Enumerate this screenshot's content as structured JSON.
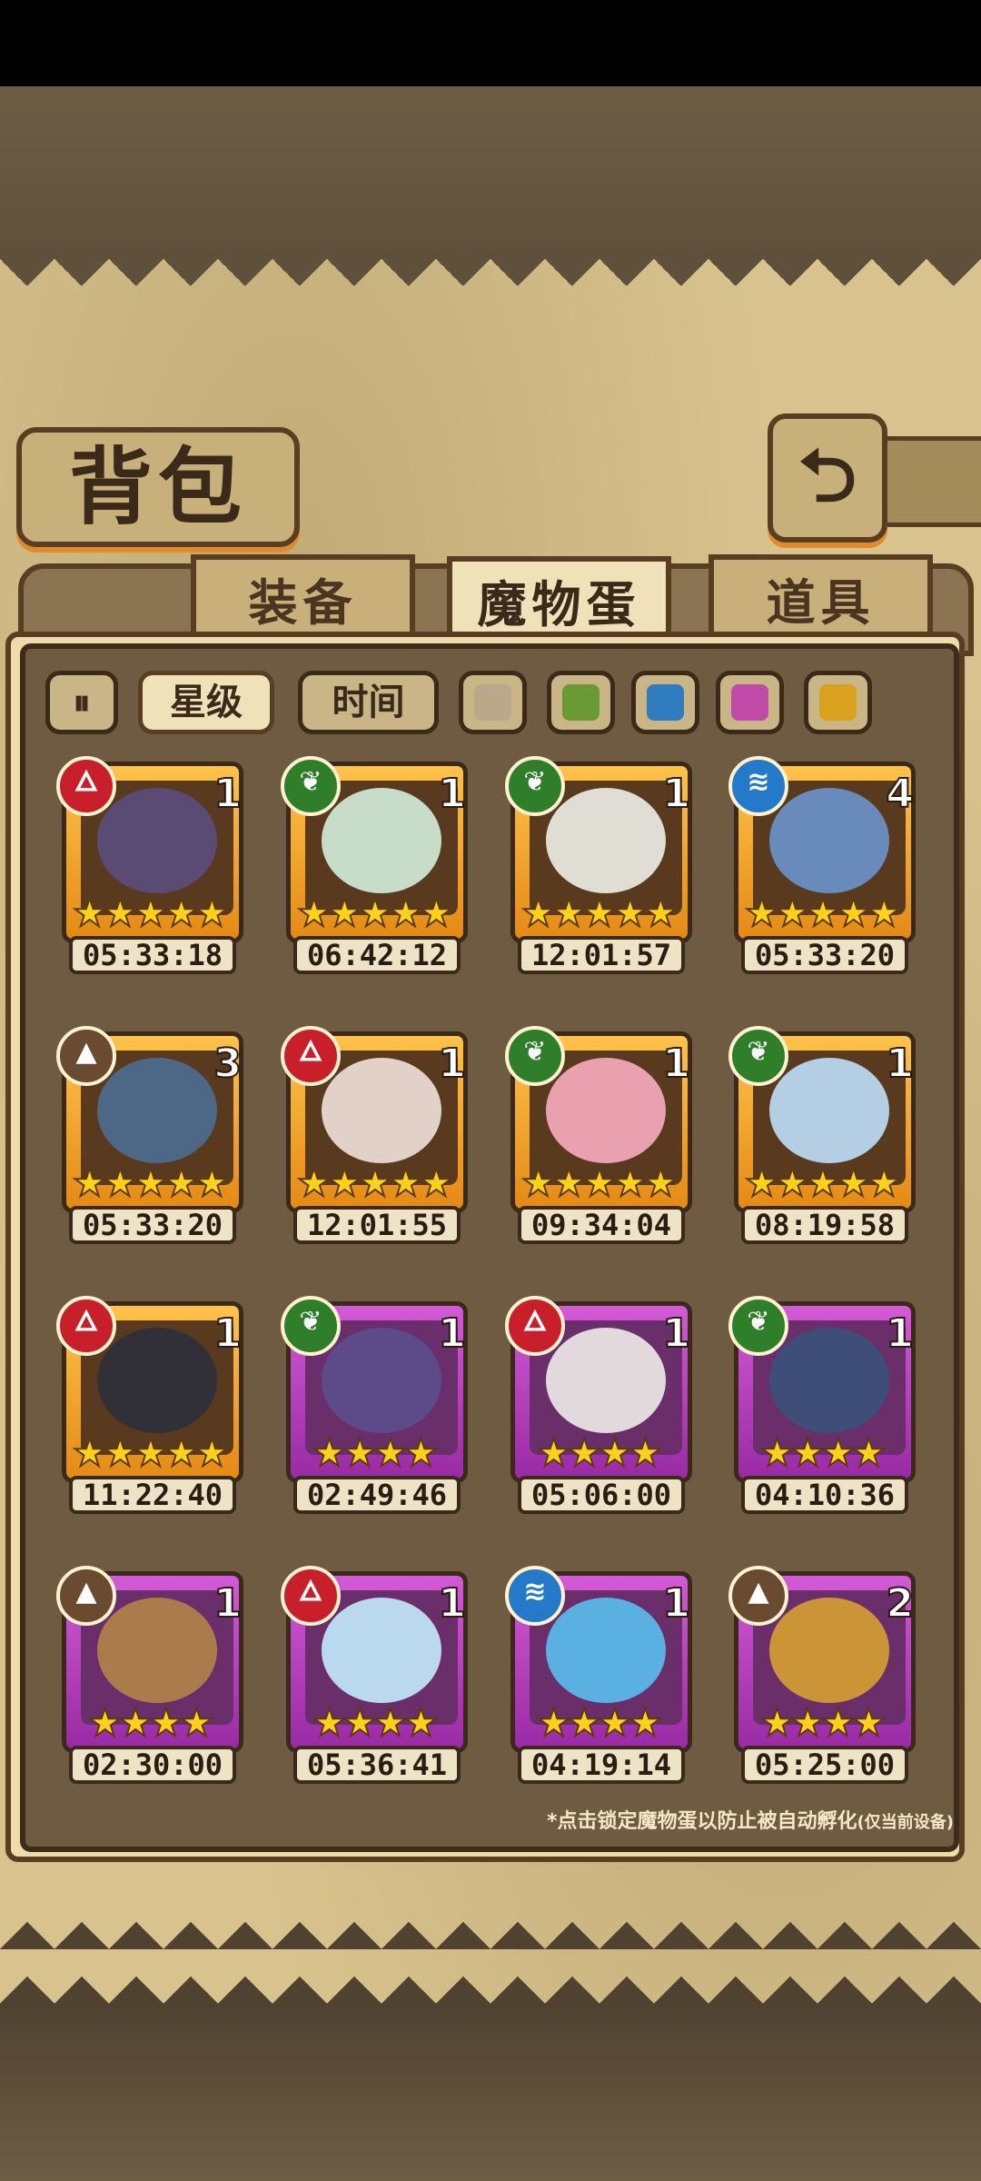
{
  "header": {
    "title": "背包",
    "back_icon": "⮌"
  },
  "tabs": [
    {
      "label": "装备",
      "active": false
    },
    {
      "label": "魔物蛋",
      "active": true
    },
    {
      "label": "道具",
      "active": false
    }
  ],
  "filters": {
    "sort_icon": "⏸",
    "star_label": "星级",
    "time_label": "时间",
    "colors": [
      "#b9a889",
      "#6a9a35",
      "#2f7dbf",
      "#c04aa8",
      "#d8a21e"
    ]
  },
  "eggs": [
    {
      "element": "fire",
      "count": "1",
      "stars": "★★★★★",
      "time": "05:33:18",
      "rarity": "gold",
      "color": "#5b4c7a"
    },
    {
      "element": "nature",
      "count": "1",
      "stars": "★★★★★",
      "time": "06:42:12",
      "rarity": "gold",
      "color": "#cfe5d4"
    },
    {
      "element": "nature",
      "count": "1",
      "stars": "★★★★★",
      "time": "12:01:57",
      "rarity": "gold",
      "color": "#e8e6df"
    },
    {
      "element": "water",
      "count": "4",
      "stars": "★★★★★",
      "time": "05:33:20",
      "rarity": "gold",
      "color": "#6a8fc4"
    },
    {
      "element": "earth",
      "count": "3",
      "stars": "★★★★★",
      "time": "05:33:20",
      "rarity": "gold",
      "color": "#4d6a8c"
    },
    {
      "element": "fire",
      "count": "1",
      "stars": "★★★★★",
      "time": "12:01:55",
      "rarity": "gold",
      "color": "#e9d9d2"
    },
    {
      "element": "nature",
      "count": "1",
      "stars": "★★★★★",
      "time": "09:34:04",
      "rarity": "gold",
      "color": "#f1a7b8"
    },
    {
      "element": "nature",
      "count": "1",
      "stars": "★★★★★",
      "time": "08:19:58",
      "rarity": "gold",
      "color": "#b9d6ef"
    },
    {
      "element": "fire",
      "count": "1",
      "stars": "★★★★★",
      "time": "11:22:40",
      "rarity": "gold",
      "color": "#2f2f3a"
    },
    {
      "element": "nature",
      "count": "1",
      "stars": "★★★★",
      "time": "02:49:46",
      "rarity": "purple",
      "color": "#5d4c8a"
    },
    {
      "element": "fire",
      "count": "1",
      "stars": "★★★★",
      "time": "05:06:00",
      "rarity": "purple",
      "color": "#e9e3e3"
    },
    {
      "element": "nature",
      "count": "1",
      "stars": "★★★★",
      "time": "04:10:36",
      "rarity": "purple",
      "color": "#3d4f7a"
    },
    {
      "element": "earth",
      "count": "1",
      "stars": "★★★★",
      "time": "02:30:00",
      "rarity": "purple",
      "color": "#b07f4a"
    },
    {
      "element": "fire",
      "count": "1",
      "stars": "★★★★",
      "time": "05:36:41",
      "rarity": "purple",
      "color": "#bfe3f7"
    },
    {
      "element": "water",
      "count": "1",
      "stars": "★★★★",
      "time": "04:19:14",
      "rarity": "purple",
      "color": "#5ab7e8"
    },
    {
      "element": "earth",
      "count": "2",
      "stars": "★★★★",
      "time": "05:25:00",
      "rarity": "purple",
      "color": "#d19a35"
    }
  ],
  "element_icons": {
    "fire": "🜂",
    "nature": "❦",
    "water": "≋",
    "earth": "▲"
  },
  "footer_note": "*点击锁定魔物蛋以防止被自动孵化",
  "footer_note_small": "(仅当前设备)"
}
